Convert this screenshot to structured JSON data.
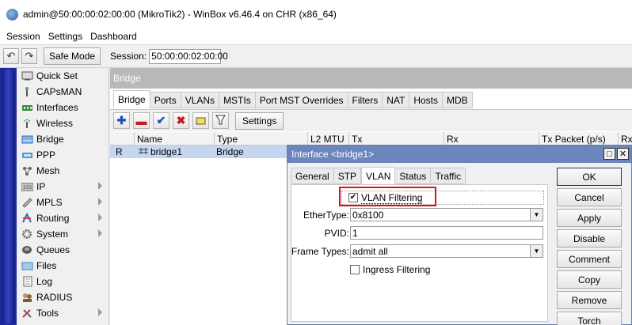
{
  "window": {
    "title": "admin@50:00:00:02:00:00 (MikroTik2) - WinBox v6.46.4 on CHR (x86_64)"
  },
  "menu": [
    "Session",
    "Settings",
    "Dashboard"
  ],
  "toolbar": {
    "undo_icon": "undo-icon",
    "redo_icon": "redo-icon",
    "safe_mode": "Safe Mode",
    "session_label": "Session:",
    "session_value": "50:00:00:02:00:00"
  },
  "sidebar": {
    "items": [
      {
        "label": "Quick Set",
        "icon": "quick-set-icon",
        "submenu": false
      },
      {
        "label": "CAPsMAN",
        "icon": "antenna-icon",
        "submenu": false
      },
      {
        "label": "Interfaces",
        "icon": "interfaces-icon",
        "submenu": false
      },
      {
        "label": "Wireless",
        "icon": "wireless-icon",
        "submenu": false
      },
      {
        "label": "Bridge",
        "icon": "bridge-icon",
        "submenu": false
      },
      {
        "label": "PPP",
        "icon": "ppp-icon",
        "submenu": false
      },
      {
        "label": "Mesh",
        "icon": "mesh-icon",
        "submenu": false
      },
      {
        "label": "IP",
        "icon": "ip-icon",
        "submenu": true
      },
      {
        "label": "MPLS",
        "icon": "mpls-icon",
        "submenu": true
      },
      {
        "label": "Routing",
        "icon": "routing-icon",
        "submenu": true
      },
      {
        "label": "System",
        "icon": "gear-icon",
        "submenu": true
      },
      {
        "label": "Queues",
        "icon": "queues-icon",
        "submenu": false
      },
      {
        "label": "Files",
        "icon": "folder-icon",
        "submenu": false
      },
      {
        "label": "Log",
        "icon": "log-icon",
        "submenu": false
      },
      {
        "label": "RADIUS",
        "icon": "radius-icon",
        "submenu": false
      },
      {
        "label": "Tools",
        "icon": "tools-icon",
        "submenu": true
      }
    ]
  },
  "bridge_window": {
    "title": "Bridge",
    "tabs": [
      "Bridge",
      "Ports",
      "VLANs",
      "MSTIs",
      "Port MST Overrides",
      "Filters",
      "NAT",
      "Hosts",
      "MDB"
    ],
    "active_tab": "Bridge",
    "settings_label": "Settings",
    "columns": [
      "Name",
      "Type",
      "L2 MTU",
      "Tx",
      "Rx",
      "Tx Packet (p/s)",
      "Rx"
    ],
    "rows": [
      {
        "flag": "R",
        "name": "bridge1",
        "type": "Bridge"
      }
    ]
  },
  "dialog": {
    "title": "Interface <bridge1>",
    "tabs": [
      "General",
      "STP",
      "VLAN",
      "Status",
      "Traffic"
    ],
    "active_tab": "VLAN",
    "vlan_filtering": {
      "label": "VLAN Filtering",
      "checked": true
    },
    "ethertype": {
      "label": "EtherType:",
      "value": "0x8100"
    },
    "pvid": {
      "label": "PVID:",
      "value": "1"
    },
    "frame_types": {
      "label": "Frame Types:",
      "value": "admit all"
    },
    "ingress_filtering": {
      "label": "Ingress Filtering",
      "checked": false
    },
    "buttons": [
      "OK",
      "Cancel",
      "Apply",
      "Disable",
      "Comment",
      "Copy",
      "Remove",
      "Torch"
    ],
    "check_mark": "✔"
  },
  "highlight_color": "#e0101a"
}
